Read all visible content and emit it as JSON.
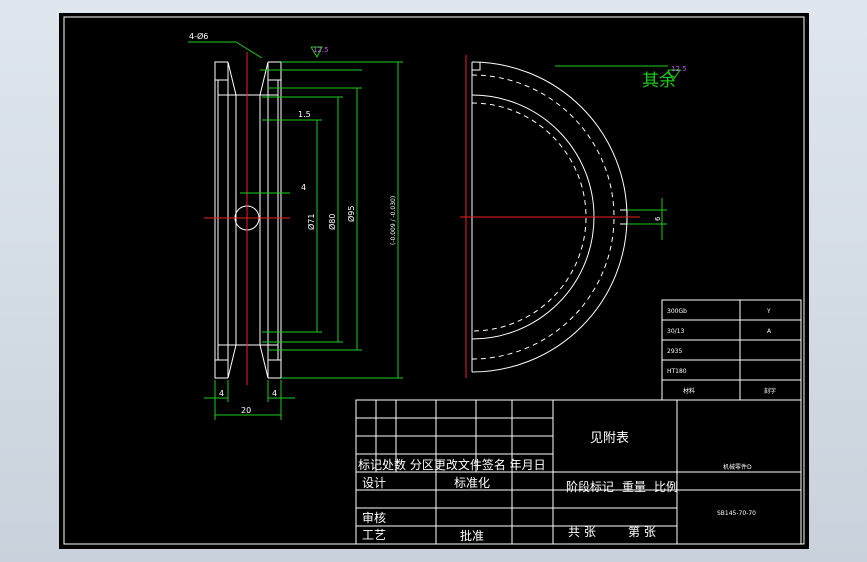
{
  "drawing": {
    "dims": {
      "holes": "4-Ø6",
      "roughness_top": "12.5",
      "d1": "1.5",
      "d2": "4",
      "dia_inner": "Ø71",
      "dia_mid": "Ø80",
      "dia_outer": "Ø95",
      "dia_outer_tol": "(-0.009 / -0.030)",
      "side_left": "4",
      "side_right": "4",
      "width": "20",
      "slot": "6",
      "roughness_rest": "12.5"
    },
    "rest_label": "其余",
    "spec_table": {
      "rows": [
        {
          "key": "300Gb",
          "val": "Y"
        },
        {
          "key": "30/13",
          "val": "A"
        },
        {
          "key": "2935",
          "val": ""
        },
        {
          "key": "HT180",
          "val": ""
        },
        {
          "key": "材料",
          "val": "刻字"
        }
      ]
    },
    "title_block": {
      "see_attached": "见附表",
      "part_name": "机械零件D",
      "drawing_no": "SB145-70-70",
      "header_row": "标记处数  分区更改文件签名 年月日",
      "design": "设计",
      "standardize": "标准化",
      "stage_mark": "阶段标记",
      "weight": "重量",
      "scale": "比例",
      "review": "审核",
      "process": "工艺",
      "approve": "批准",
      "total_sheets": "共  张",
      "sheet_no": "第  张"
    }
  }
}
